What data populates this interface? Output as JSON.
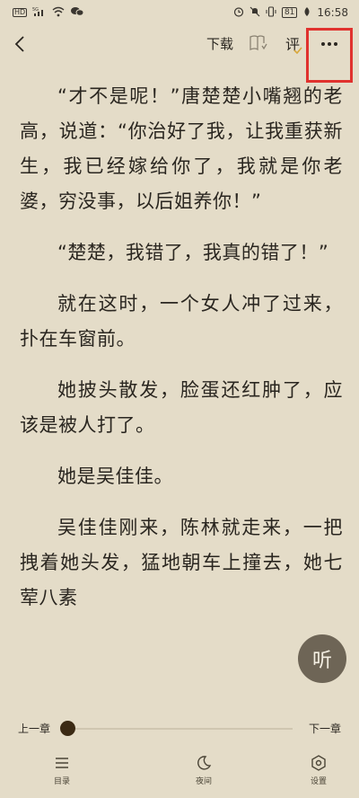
{
  "status_bar": {
    "left_icons": [
      "HD",
      "5G",
      "wifi",
      "wechat"
    ],
    "right_icons": [
      "alarm",
      "mute",
      "vibrate"
    ],
    "battery": "81",
    "time": "16:58"
  },
  "toolbar": {
    "download_label": "下载",
    "comment_label": "评"
  },
  "content": {
    "paragraphs": [
      "“才不是呢！”唐楚楚小嘴翘的老高，说道：“你治好了我，让我重获新生，我已经嫁给你了，我就是你老婆，穷没事，以后姐养你！”",
      "“楚楚，我错了，我真的错了！”",
      "就在这时，一个女人冲了过来，扑在车窗前。",
      "她披头散发，脸蛋还红肿了，应该是被人打了。",
      "她是吴佳佳。",
      "吴佳佳刚来，陈林就走来，一把拽着她头发，猛地朝车上撞去，她七荤八素"
    ]
  },
  "listen_button": {
    "label": "听"
  },
  "chapter_nav": {
    "prev_label": "上一章",
    "next_label": "下一章",
    "progress": 0.0
  },
  "bottom_nav": {
    "items": [
      {
        "label": "目录",
        "icon": "menu-icon"
      },
      {
        "label": "夜间",
        "icon": "moon-icon"
      },
      {
        "label": "设置",
        "icon": "settings-icon"
      }
    ]
  },
  "colors": {
    "background": "#e4dcc8",
    "text": "#2a2620",
    "listen_button": "#6e6556",
    "highlight": "#e0322e",
    "accent": "#d8a73b"
  }
}
